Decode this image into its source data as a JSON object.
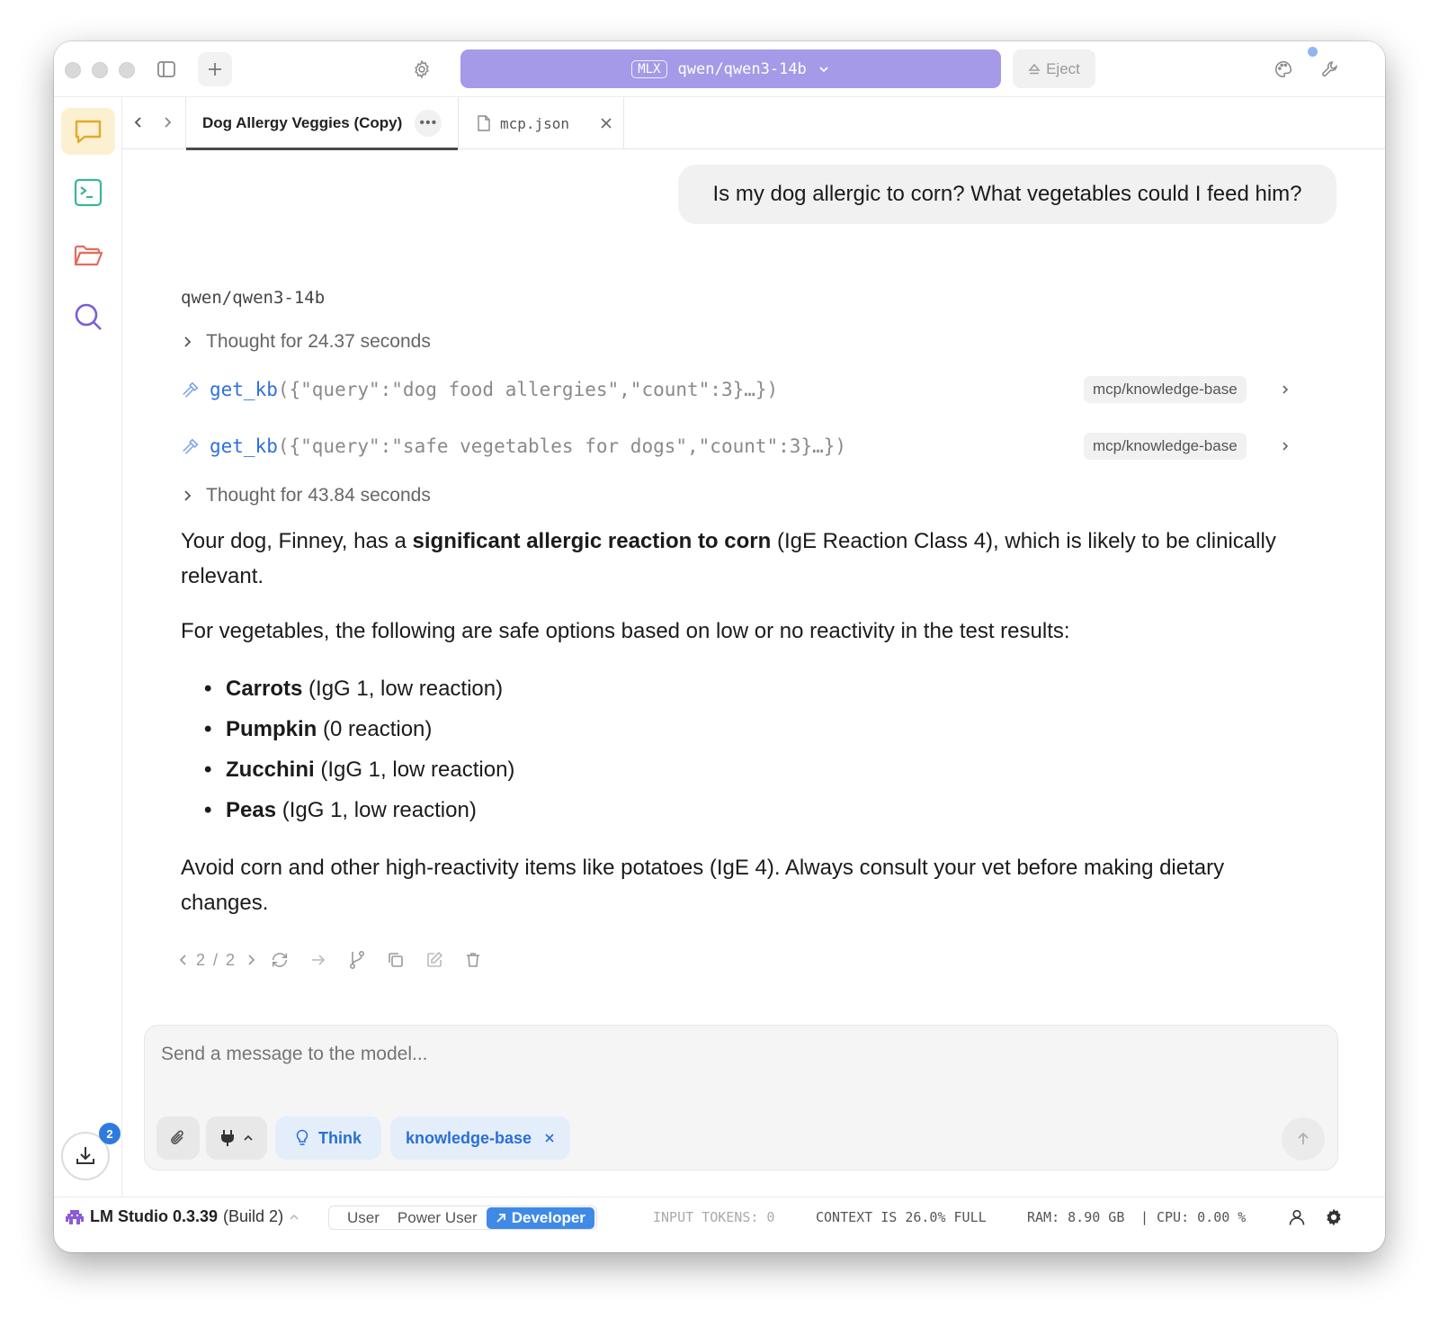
{
  "window": {
    "model_badge": "MLX",
    "model_name": "qwen/qwen3-14b",
    "eject_label": "Eject"
  },
  "tabs": [
    {
      "title": "Dog Allergy Veggies (Copy)",
      "more": "•••",
      "active": true
    },
    {
      "title": "mcp.json",
      "active": false
    }
  ],
  "chat": {
    "user_message": "Is my dog allergic to corn? What vegetables could I feed him?",
    "model_label": "qwen/qwen3-14b",
    "thought_1": "Thought for 24.37 seconds",
    "tool_calls": [
      {
        "fn": "get_kb",
        "args": "({\"query\":\"dog food allergies\",\"count\":3}…})",
        "tag": "mcp/knowledge-base"
      },
      {
        "fn": "get_kb",
        "args": "({\"query\":\"safe vegetables for dogs\",\"count\":3}…})",
        "tag": "mcp/knowledge-base"
      }
    ],
    "thought_2": "Thought for 43.84 seconds",
    "answer": {
      "p1_pre": "Your dog, Finney, has a ",
      "p1_bold": "significant allergic reaction to corn",
      "p1_post": " (IgE Reaction Class 4), which is likely to be clinically relevant.",
      "p2": "For vegetables, the following are safe options based on low or no reactivity in the test results:",
      "items": [
        {
          "name": "Carrots",
          "detail": " (IgG 1, low reaction)"
        },
        {
          "name": "Pumpkin",
          "detail": " (0 reaction)"
        },
        {
          "name": "Zucchini",
          "detail": " (IgG 1, low reaction)"
        },
        {
          "name": "Peas",
          "detail": " (IgG 1, low reaction)"
        }
      ],
      "p3": "Avoid corn and other high-reactivity items like potatoes (IgE 4). Always consult your vet before making dietary changes."
    },
    "pager": "2 / 2"
  },
  "composer": {
    "placeholder": "Send a message to the model...",
    "think_label": "Think",
    "kb_chip_label": "knowledge-base"
  },
  "downloads": {
    "count": "2"
  },
  "status": {
    "app_name": "LM Studio 0.3.39",
    "build": "(Build 2)",
    "modes": [
      "User",
      "Power User",
      "Developer"
    ],
    "input_tokens": "INPUT TOKENS:  0",
    "context": "CONTEXT IS 26.0% FULL",
    "ram": "RAM: 8.90 GB",
    "cpu": "CPU: 0.00 %"
  },
  "colors": {
    "accent": "#a49ae8",
    "link_blue": "#2f6fdc",
    "developer_mode": "#3f8ae6",
    "chat_icon": "#e3a92a",
    "terminal_icon": "#39b79a",
    "folder_icon": "#e26d5c",
    "search_icon": "#7c5cd6"
  }
}
